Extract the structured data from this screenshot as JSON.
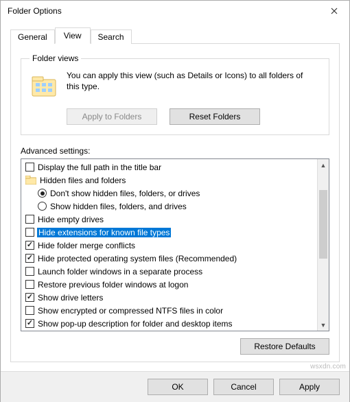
{
  "window": {
    "title": "Folder Options"
  },
  "tabs": {
    "general": "General",
    "view": "View",
    "search": "Search"
  },
  "folderViews": {
    "legend": "Folder views",
    "description": "You can apply this view (such as Details or Icons) to all folders of this type.",
    "applyBtn": "Apply to Folders",
    "resetBtn": "Reset Folders"
  },
  "advanced": {
    "label": "Advanced settings:",
    "items": [
      {
        "kind": "chk",
        "checked": false,
        "indent": 0,
        "name": "display-full-path",
        "label": "Display the full path in the title bar"
      },
      {
        "kind": "folder",
        "indent": 0,
        "name": "hidden-files-group",
        "label": "Hidden files and folders"
      },
      {
        "kind": "rad",
        "checked": true,
        "indent": 1,
        "name": "dont-show-hidden",
        "label": "Don't show hidden files, folders, or drives"
      },
      {
        "kind": "rad",
        "checked": false,
        "indent": 1,
        "name": "show-hidden",
        "label": "Show hidden files, folders, and drives"
      },
      {
        "kind": "chk",
        "checked": false,
        "indent": 0,
        "name": "hide-empty-drives",
        "label": "Hide empty drives"
      },
      {
        "kind": "chk",
        "checked": false,
        "indent": 0,
        "name": "hide-extensions",
        "label": "Hide extensions for known file types",
        "selected": true
      },
      {
        "kind": "chk",
        "checked": true,
        "indent": 0,
        "name": "hide-merge-conflicts",
        "label": "Hide folder merge conflicts"
      },
      {
        "kind": "chk",
        "checked": true,
        "indent": 0,
        "name": "hide-protected-os",
        "label": "Hide protected operating system files (Recommended)"
      },
      {
        "kind": "chk",
        "checked": false,
        "indent": 0,
        "name": "launch-separate-process",
        "label": "Launch folder windows in a separate process"
      },
      {
        "kind": "chk",
        "checked": false,
        "indent": 0,
        "name": "restore-previous",
        "label": "Restore previous folder windows at logon"
      },
      {
        "kind": "chk",
        "checked": true,
        "indent": 0,
        "name": "show-drive-letters",
        "label": "Show drive letters"
      },
      {
        "kind": "chk",
        "checked": false,
        "indent": 0,
        "name": "show-encrypted-color",
        "label": "Show encrypted or compressed NTFS files in color"
      },
      {
        "kind": "chk",
        "checked": true,
        "indent": 0,
        "name": "show-popup-desc",
        "label": "Show pop-up description for folder and desktop items"
      }
    ],
    "restoreDefaults": "Restore Defaults"
  },
  "buttons": {
    "ok": "OK",
    "cancel": "Cancel",
    "apply": "Apply"
  }
}
